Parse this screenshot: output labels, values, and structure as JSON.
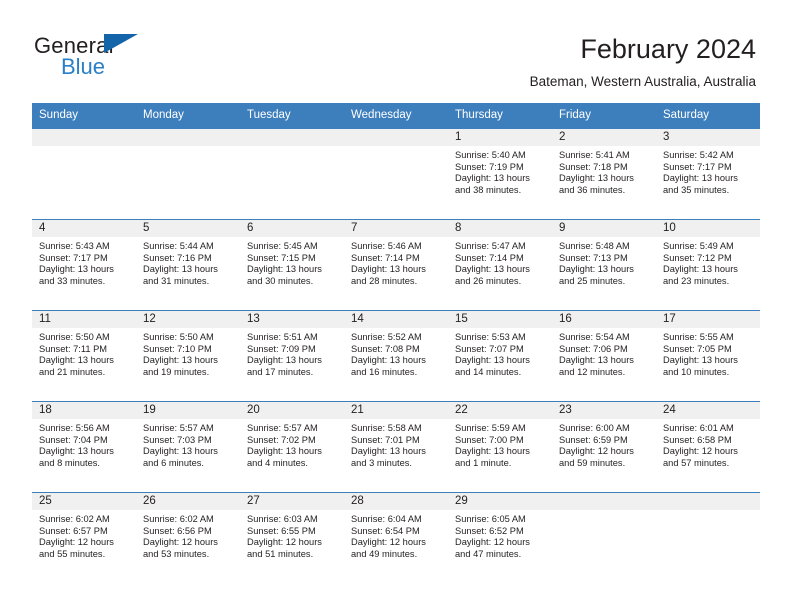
{
  "logo": {
    "word1": "General",
    "word2": "Blue",
    "triangle_color": "#1464aa",
    "blue_color": "#2a7fc9"
  },
  "header": {
    "title": "February 2024",
    "subtitle": "Bateman, Western Australia, Australia"
  },
  "theme": {
    "header_blue": "#3d7ebd",
    "date_band": "#f0f0f0",
    "text": "#231f20"
  },
  "weekdays": [
    "Sunday",
    "Monday",
    "Tuesday",
    "Wednesday",
    "Thursday",
    "Friday",
    "Saturday"
  ],
  "weeks": [
    [
      {
        "day": "",
        "empty": true
      },
      {
        "day": "",
        "empty": true
      },
      {
        "day": "",
        "empty": true
      },
      {
        "day": "",
        "empty": true
      },
      {
        "day": "1",
        "sunrise": "Sunrise: 5:40 AM",
        "sunset": "Sunset: 7:19 PM",
        "daylight1": "Daylight: 13 hours",
        "daylight2": "and 38 minutes."
      },
      {
        "day": "2",
        "sunrise": "Sunrise: 5:41 AM",
        "sunset": "Sunset: 7:18 PM",
        "daylight1": "Daylight: 13 hours",
        "daylight2": "and 36 minutes."
      },
      {
        "day": "3",
        "sunrise": "Sunrise: 5:42 AM",
        "sunset": "Sunset: 7:17 PM",
        "daylight1": "Daylight: 13 hours",
        "daylight2": "and 35 minutes."
      }
    ],
    [
      {
        "day": "4",
        "sunrise": "Sunrise: 5:43 AM",
        "sunset": "Sunset: 7:17 PM",
        "daylight1": "Daylight: 13 hours",
        "daylight2": "and 33 minutes."
      },
      {
        "day": "5",
        "sunrise": "Sunrise: 5:44 AM",
        "sunset": "Sunset: 7:16 PM",
        "daylight1": "Daylight: 13 hours",
        "daylight2": "and 31 minutes."
      },
      {
        "day": "6",
        "sunrise": "Sunrise: 5:45 AM",
        "sunset": "Sunset: 7:15 PM",
        "daylight1": "Daylight: 13 hours",
        "daylight2": "and 30 minutes."
      },
      {
        "day": "7",
        "sunrise": "Sunrise: 5:46 AM",
        "sunset": "Sunset: 7:14 PM",
        "daylight1": "Daylight: 13 hours",
        "daylight2": "and 28 minutes."
      },
      {
        "day": "8",
        "sunrise": "Sunrise: 5:47 AM",
        "sunset": "Sunset: 7:14 PM",
        "daylight1": "Daylight: 13 hours",
        "daylight2": "and 26 minutes."
      },
      {
        "day": "9",
        "sunrise": "Sunrise: 5:48 AM",
        "sunset": "Sunset: 7:13 PM",
        "daylight1": "Daylight: 13 hours",
        "daylight2": "and 25 minutes."
      },
      {
        "day": "10",
        "sunrise": "Sunrise: 5:49 AM",
        "sunset": "Sunset: 7:12 PM",
        "daylight1": "Daylight: 13 hours",
        "daylight2": "and 23 minutes."
      }
    ],
    [
      {
        "day": "11",
        "sunrise": "Sunrise: 5:50 AM",
        "sunset": "Sunset: 7:11 PM",
        "daylight1": "Daylight: 13 hours",
        "daylight2": "and 21 minutes."
      },
      {
        "day": "12",
        "sunrise": "Sunrise: 5:50 AM",
        "sunset": "Sunset: 7:10 PM",
        "daylight1": "Daylight: 13 hours",
        "daylight2": "and 19 minutes."
      },
      {
        "day": "13",
        "sunrise": "Sunrise: 5:51 AM",
        "sunset": "Sunset: 7:09 PM",
        "daylight1": "Daylight: 13 hours",
        "daylight2": "and 17 minutes."
      },
      {
        "day": "14",
        "sunrise": "Sunrise: 5:52 AM",
        "sunset": "Sunset: 7:08 PM",
        "daylight1": "Daylight: 13 hours",
        "daylight2": "and 16 minutes."
      },
      {
        "day": "15",
        "sunrise": "Sunrise: 5:53 AM",
        "sunset": "Sunset: 7:07 PM",
        "daylight1": "Daylight: 13 hours",
        "daylight2": "and 14 minutes."
      },
      {
        "day": "16",
        "sunrise": "Sunrise: 5:54 AM",
        "sunset": "Sunset: 7:06 PM",
        "daylight1": "Daylight: 13 hours",
        "daylight2": "and 12 minutes."
      },
      {
        "day": "17",
        "sunrise": "Sunrise: 5:55 AM",
        "sunset": "Sunset: 7:05 PM",
        "daylight1": "Daylight: 13 hours",
        "daylight2": "and 10 minutes."
      }
    ],
    [
      {
        "day": "18",
        "sunrise": "Sunrise: 5:56 AM",
        "sunset": "Sunset: 7:04 PM",
        "daylight1": "Daylight: 13 hours",
        "daylight2": "and 8 minutes."
      },
      {
        "day": "19",
        "sunrise": "Sunrise: 5:57 AM",
        "sunset": "Sunset: 7:03 PM",
        "daylight1": "Daylight: 13 hours",
        "daylight2": "and 6 minutes."
      },
      {
        "day": "20",
        "sunrise": "Sunrise: 5:57 AM",
        "sunset": "Sunset: 7:02 PM",
        "daylight1": "Daylight: 13 hours",
        "daylight2": "and 4 minutes."
      },
      {
        "day": "21",
        "sunrise": "Sunrise: 5:58 AM",
        "sunset": "Sunset: 7:01 PM",
        "daylight1": "Daylight: 13 hours",
        "daylight2": "and 3 minutes."
      },
      {
        "day": "22",
        "sunrise": "Sunrise: 5:59 AM",
        "sunset": "Sunset: 7:00 PM",
        "daylight1": "Daylight: 13 hours",
        "daylight2": "and 1 minute."
      },
      {
        "day": "23",
        "sunrise": "Sunrise: 6:00 AM",
        "sunset": "Sunset: 6:59 PM",
        "daylight1": "Daylight: 12 hours",
        "daylight2": "and 59 minutes."
      },
      {
        "day": "24",
        "sunrise": "Sunrise: 6:01 AM",
        "sunset": "Sunset: 6:58 PM",
        "daylight1": "Daylight: 12 hours",
        "daylight2": "and 57 minutes."
      }
    ],
    [
      {
        "day": "25",
        "sunrise": "Sunrise: 6:02 AM",
        "sunset": "Sunset: 6:57 PM",
        "daylight1": "Daylight: 12 hours",
        "daylight2": "and 55 minutes."
      },
      {
        "day": "26",
        "sunrise": "Sunrise: 6:02 AM",
        "sunset": "Sunset: 6:56 PM",
        "daylight1": "Daylight: 12 hours",
        "daylight2": "and 53 minutes."
      },
      {
        "day": "27",
        "sunrise": "Sunrise: 6:03 AM",
        "sunset": "Sunset: 6:55 PM",
        "daylight1": "Daylight: 12 hours",
        "daylight2": "and 51 minutes."
      },
      {
        "day": "28",
        "sunrise": "Sunrise: 6:04 AM",
        "sunset": "Sunset: 6:54 PM",
        "daylight1": "Daylight: 12 hours",
        "daylight2": "and 49 minutes."
      },
      {
        "day": "29",
        "sunrise": "Sunrise: 6:05 AM",
        "sunset": "Sunset: 6:52 PM",
        "daylight1": "Daylight: 12 hours",
        "daylight2": "and 47 minutes."
      },
      {
        "day": "",
        "empty": true
      },
      {
        "day": "",
        "empty": true
      }
    ]
  ]
}
